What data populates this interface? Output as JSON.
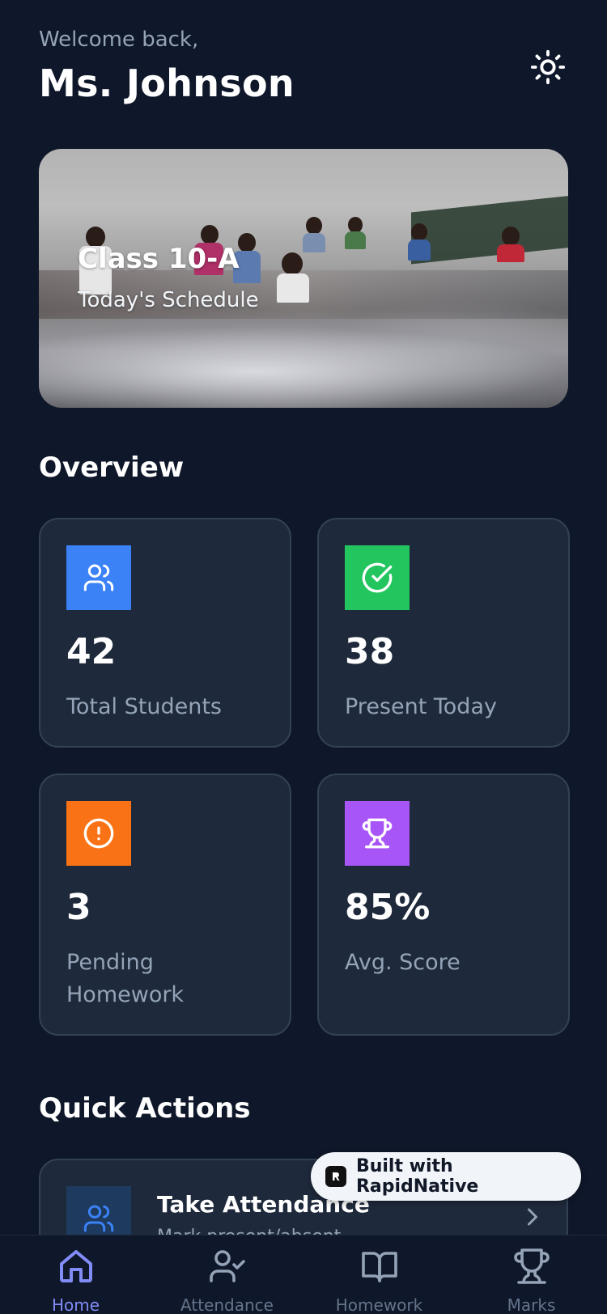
{
  "header": {
    "welcome": "Welcome back,",
    "name": "Ms. Johnson",
    "theme_icon": "sun-icon"
  },
  "hero": {
    "title": "Class 10-A",
    "subtitle": "Today's Schedule"
  },
  "overview": {
    "title": "Overview",
    "stats": [
      {
        "value": "42",
        "label": "Total Students",
        "icon": "users-icon",
        "color": "#3b82f6"
      },
      {
        "value": "38",
        "label": "Present Today",
        "icon": "check-circle-icon",
        "color": "#22c55e"
      },
      {
        "value": "3",
        "label": "Pending Homework",
        "icon": "alert-circle-icon",
        "color": "#f97316"
      },
      {
        "value": "85%",
        "label": "Avg. Score",
        "icon": "trophy-icon",
        "color": "#a855f7"
      }
    ]
  },
  "quick_actions": {
    "title": "Quick Actions",
    "items": [
      {
        "title": "Take Attendance",
        "subtitle": "Mark present/absent",
        "icon": "users-icon"
      }
    ]
  },
  "badge": {
    "text": "Built with RapidNative"
  },
  "tabs": [
    {
      "label": "Home",
      "icon": "home-icon",
      "active": true
    },
    {
      "label": "Attendance",
      "icon": "user-check-icon",
      "active": false
    },
    {
      "label": "Homework",
      "icon": "book-open-icon",
      "active": false
    },
    {
      "label": "Marks",
      "icon": "trophy-icon",
      "active": false
    }
  ],
  "colors": {
    "background": "#0f172a",
    "card": "#1e293b",
    "accent": "#818cf8"
  }
}
